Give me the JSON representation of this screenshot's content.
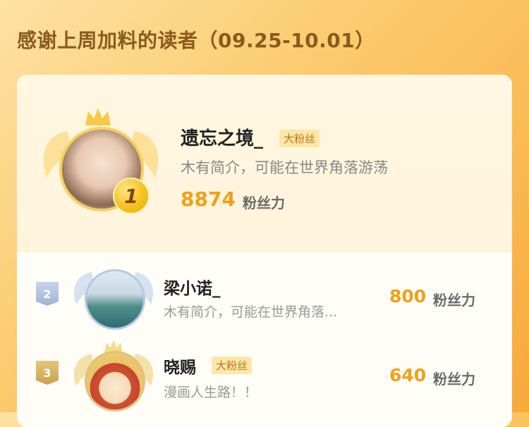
{
  "header": {
    "title": "感谢上周加料的读者（09.25-10.01）"
  },
  "ranking": [
    {
      "rank": "1",
      "name": "遗忘之境_",
      "tag": "大粉丝",
      "bio": "木有简介，可能在世界角落游荡",
      "score": "8874",
      "score_label": "粉丝力"
    },
    {
      "rank": "2",
      "name": "梁小诺_",
      "tag": "",
      "bio": "木有简介，可能在世界角落...",
      "score": "800",
      "score_label": "粉丝力"
    },
    {
      "rank": "3",
      "name": "晓赐",
      "tag": "大粉丝",
      "bio": "漫画人生路！！",
      "score": "640",
      "score_label": "粉丝力"
    }
  ],
  "colors": {
    "accent": "#f0a019",
    "gold": "#f5c21e",
    "silver": "#b7c8e6",
    "bronze": "#d8b45a"
  }
}
